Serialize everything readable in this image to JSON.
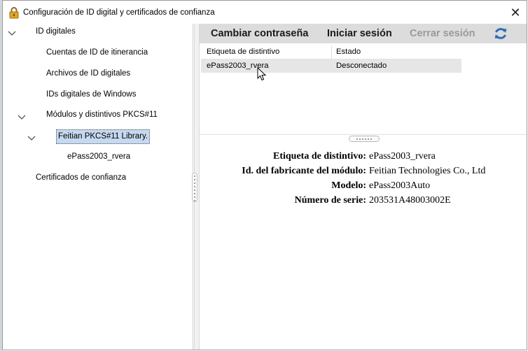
{
  "window": {
    "title": "Configuración de ID digital y certificados de confianza",
    "title_icon": "lock-icon",
    "close_icon": "close-icon"
  },
  "tree": {
    "items": [
      {
        "label": "ID digitales",
        "expanded": true
      },
      {
        "label": "Cuentas de ID de itinerancia"
      },
      {
        "label": "Archivos de ID digitales"
      },
      {
        "label": "IDs digitales de Windows"
      },
      {
        "label": "Módulos y distintivos PKCS#11",
        "expanded": true
      },
      {
        "label": "Feitian PKCS#11 Library.",
        "expanded": true,
        "selected": true
      },
      {
        "label": "ePass2003_rvera"
      },
      {
        "label": "Certificados de confianza"
      }
    ]
  },
  "toolbar": {
    "change_password": "Cambiar contraseña",
    "login": "Iniciar sesión",
    "logout": "Cerrar sesión",
    "logout_enabled": false,
    "refresh_icon": "refresh-icon",
    "accent": "#2d6db5"
  },
  "token_table": {
    "columns": [
      "Etiqueta de distintivo",
      "Estado"
    ],
    "rows": [
      {
        "label": "ePass2003_rvera",
        "status": "Desconectado"
      }
    ]
  },
  "details": {
    "rows": [
      {
        "label": "Etiqueta de distintivo:",
        "value": "ePass2003_rvera"
      },
      {
        "label": "Id. del fabricante del módulo:",
        "value": "Feitian Technologies Co., Ltd"
      },
      {
        "label": "Modelo:",
        "value": "ePass2003Auto"
      },
      {
        "label": "Número de serie:",
        "value": "203531A48003002E"
      }
    ]
  },
  "colors": {
    "toolbar_bg": "#dcdcdc",
    "selected_tree_bg": "#c5d9f0",
    "selected_row_bg": "#e6e6e6"
  }
}
